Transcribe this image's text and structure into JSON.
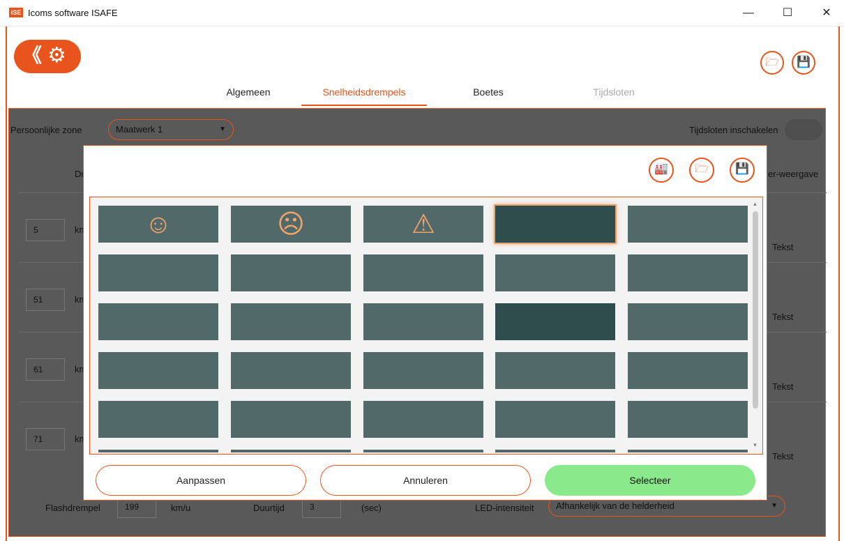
{
  "window": {
    "title": "Icoms software ISAFE",
    "app_icon_text": "iSE",
    "minimize": "—",
    "maximize": "☐",
    "close": "✕"
  },
  "toolbar": {
    "back_glyph": "《",
    "gear_glyph": "⚙",
    "open_glyph": "🗁",
    "save_glyph": "💾"
  },
  "tabs": [
    {
      "label": "Algemeen"
    },
    {
      "label": "Snelheidsdrempels"
    },
    {
      "label": "Boetes"
    },
    {
      "label": "Tijdsloten"
    }
  ],
  "background": {
    "zone_label": "Persoonlijke zone",
    "zone_value": "Maatwerk 1",
    "timeslots_label": "Tijdsloten inschakelen",
    "header_left": "Dr",
    "header_right": "er-weergave",
    "rows": [
      {
        "speed": "5",
        "unit": "km",
        "mode": "Tekst"
      },
      {
        "speed": "51",
        "unit": "km",
        "mode": "Tekst"
      },
      {
        "speed": "61",
        "unit": "km",
        "mode": "Tekst"
      },
      {
        "speed": "71",
        "unit": "km",
        "mode": "Tekst"
      }
    ],
    "flash_label": "Flashdrempel",
    "flash_value": "199",
    "flash_unit": "km/u",
    "duration_label": "Duurtijd",
    "duration_value": "3",
    "duration_unit": "(sec)",
    "led_label": "LED-intensiteit",
    "led_value": "Afhankelijk van de helderheid"
  },
  "modal": {
    "factory_glyph": "🏭",
    "open_glyph": "🗁",
    "save_glyph": "💾",
    "tiles": [
      {
        "glyph": "☺",
        "selected": false,
        "dark": false
      },
      {
        "glyph": "☹",
        "selected": false,
        "dark": false
      },
      {
        "glyph": "⚠",
        "selected": false,
        "dark": false
      },
      {
        "glyph": "",
        "selected": true,
        "dark": true
      },
      {
        "glyph": "",
        "selected": false,
        "dark": false
      },
      {
        "glyph": "",
        "selected": false,
        "dark": false
      },
      {
        "glyph": "",
        "selected": false,
        "dark": false
      },
      {
        "glyph": "",
        "selected": false,
        "dark": false
      },
      {
        "glyph": "",
        "selected": false,
        "dark": false
      },
      {
        "glyph": "",
        "selected": false,
        "dark": false
      },
      {
        "glyph": "",
        "selected": false,
        "dark": false
      },
      {
        "glyph": "",
        "selected": false,
        "dark": false
      },
      {
        "glyph": "",
        "selected": false,
        "dark": false
      },
      {
        "glyph": "",
        "selected": false,
        "dark": true
      },
      {
        "glyph": "",
        "selected": false,
        "dark": false
      },
      {
        "glyph": "",
        "selected": false,
        "dark": false
      },
      {
        "glyph": "",
        "selected": false,
        "dark": false
      },
      {
        "glyph": "",
        "selected": false,
        "dark": false
      },
      {
        "glyph": "",
        "selected": false,
        "dark": false
      },
      {
        "glyph": "",
        "selected": false,
        "dark": false
      },
      {
        "glyph": "",
        "selected": false,
        "dark": false
      },
      {
        "glyph": "",
        "selected": false,
        "dark": false
      },
      {
        "glyph": "",
        "selected": false,
        "dark": false
      },
      {
        "glyph": "",
        "selected": false,
        "dark": false
      },
      {
        "glyph": "",
        "selected": false,
        "dark": false
      }
    ],
    "buttons": {
      "adjust": "Aanpassen",
      "cancel": "Annuleren",
      "select": "Selecteer"
    }
  },
  "colors": {
    "accent": "#e8541c",
    "tile": "#52696a",
    "tile_dark": "#2f4d4d",
    "tile_glyph": "#f2a46b",
    "select_button": "#8ae98a"
  }
}
